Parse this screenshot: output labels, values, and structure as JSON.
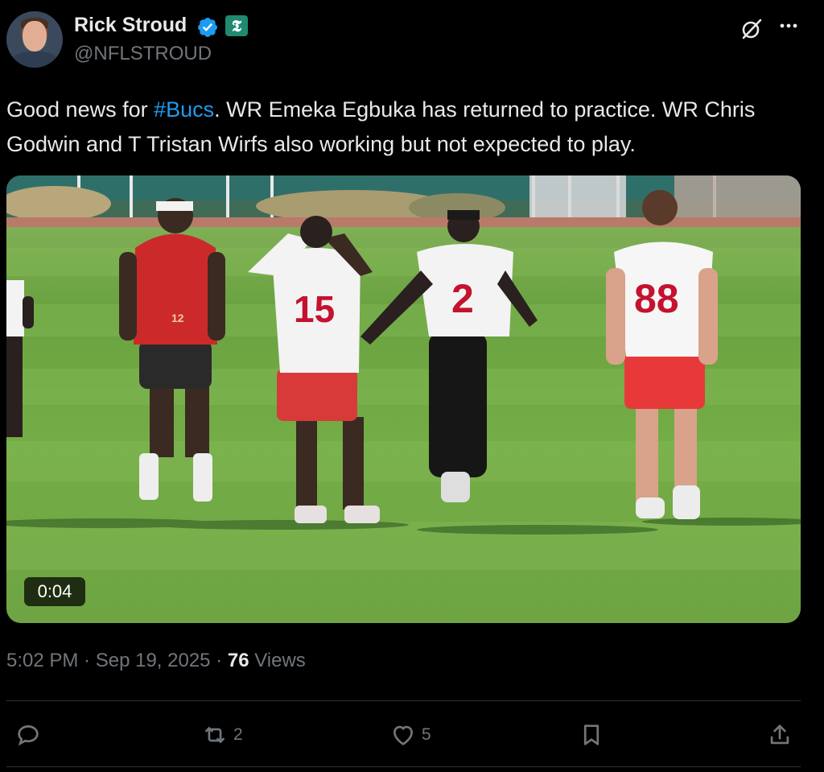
{
  "author": {
    "name": "Rick Stroud",
    "handle": "@NFLSTROUD",
    "affiliate_badge": "𝕿"
  },
  "tweet": {
    "text_before": "Good news for ",
    "hashtag": "#Bucs",
    "text_after": ". WR Emeka Egbuka has returned to practice. WR Chris Godwin and T Tristan Wirfs also working but not expected to play."
  },
  "media": {
    "duration": "0:04",
    "jersey_numbers": [
      "12",
      "15",
      "2",
      "88"
    ]
  },
  "meta": {
    "time": "5:02 PM",
    "sep1": " · ",
    "date": "Sep 19, 2025",
    "sep2": " · ",
    "views_count": "76",
    "views_label": " Views"
  },
  "actions": {
    "reply_count": "",
    "retweet_count": "2",
    "like_count": "5"
  },
  "colors": {
    "background": "#000000",
    "text": "#e7e9ea",
    "muted": "#71767b",
    "accent": "#1d9bf0",
    "divider": "#2f3336"
  },
  "icons": {
    "verified": "verified-badge-icon",
    "grok": "grok-icon",
    "more": "more-options-icon",
    "reply": "reply-icon",
    "retweet": "retweet-icon",
    "like": "heart-icon",
    "bookmark": "bookmark-icon",
    "share": "share-icon"
  }
}
